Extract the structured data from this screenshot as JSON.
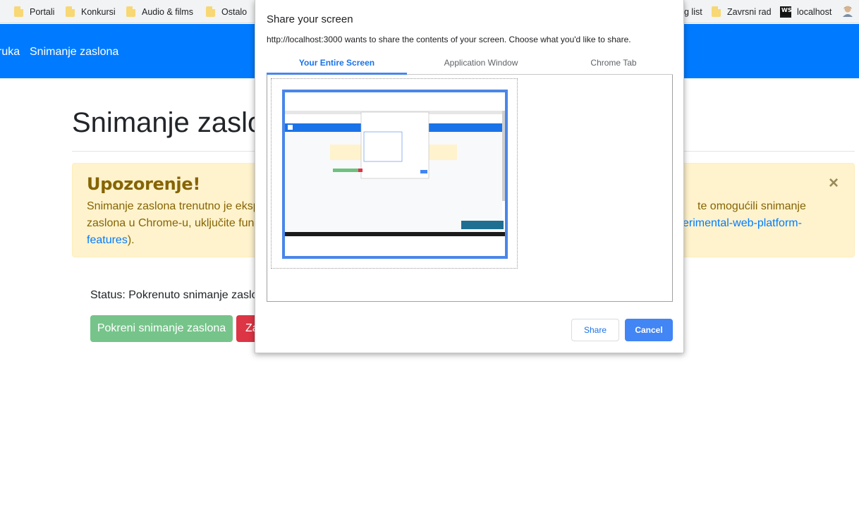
{
  "bookmarks": {
    "items": [
      {
        "label": "Portali",
        "icon": "folder-icon"
      },
      {
        "label": "Konkursi",
        "icon": "folder-icon"
      },
      {
        "label": "Audio & films",
        "icon": "folder-icon"
      },
      {
        "label": "Ostalo",
        "icon": "folder-icon"
      },
      {
        "label": "g list",
        "icon": ""
      },
      {
        "label": "Zavrsni rad",
        "icon": "folder-icon"
      },
      {
        "label": "localhost",
        "icon": "webstorm-icon"
      }
    ],
    "ws_glyph": "WS",
    "colors": {
      "folder": "#f8d775",
      "bar": "#f1f3f4"
    }
  },
  "navbar": {
    "links": [
      "ruka",
      "Snimanje zaslona"
    ],
    "color": "#007bff"
  },
  "page": {
    "title": "Snimanje zaslo",
    "alert": {
      "title": "Upozorenje!",
      "line1_left": "Snimanje zaslona trenutno je eksp",
      "line1_right": "te omogućili snimanje",
      "line2_left": "zaslona u Chrome-u, uključite funk",
      "line2_link": "erimental-web-platform-",
      "line3_link": "features",
      "line3_tail": ").",
      "close": "×",
      "colors": {
        "bg": "#fff3cd",
        "text": "#856404"
      }
    },
    "status": "Status: Pokrenuto snimanje zaslon",
    "buttons": {
      "start": "Pokreni snimanje zaslona",
      "stop": "Za"
    }
  },
  "dialog": {
    "title": "Share your screen",
    "description": "http://localhost:3000 wants to share the contents of your screen. Choose what you'd like to share.",
    "tabs": [
      "Your Entire Screen",
      "Application Window",
      "Chrome Tab"
    ],
    "active_tab": "Your Entire Screen",
    "share": "Share",
    "cancel": "Cancel",
    "colors": {
      "accent": "#4285f4",
      "active_tab": "#1a73e8"
    }
  }
}
